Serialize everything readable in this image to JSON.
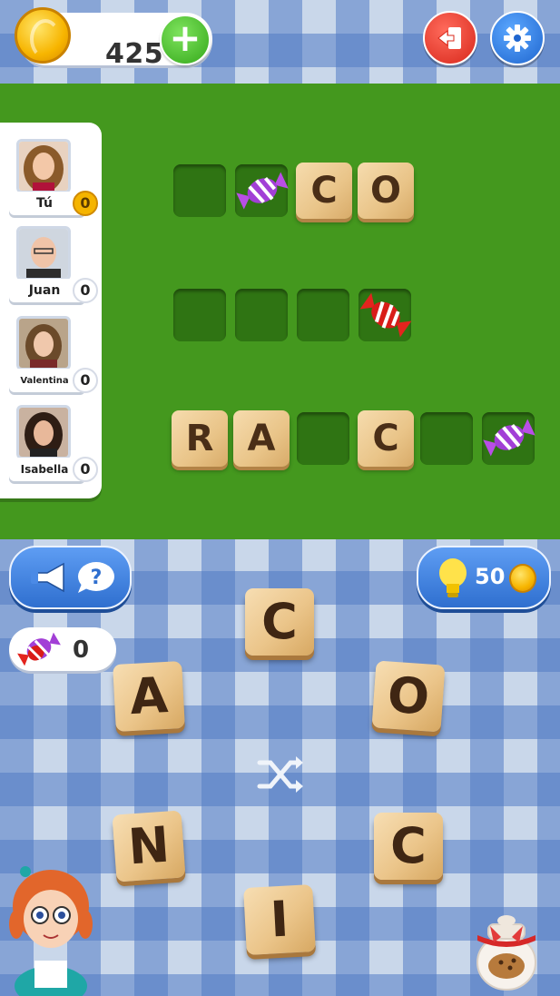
{
  "header": {
    "coins": "425",
    "icons": {
      "coin": "coin-icon",
      "add": "plus-icon",
      "exit": "exit-icon",
      "settings": "gear-icon"
    }
  },
  "players": [
    {
      "name": "Tú",
      "score": "0",
      "me": true
    },
    {
      "name": "Juan",
      "score": "0"
    },
    {
      "name": "Valentina",
      "score": "0"
    },
    {
      "name": "Isabella",
      "score": "0"
    }
  ],
  "board": {
    "rows": [
      [
        "",
        "candy-purple",
        "C",
        "O"
      ],
      [
        "",
        "",
        "",
        "candy-red"
      ],
      [
        "R",
        "A",
        "",
        "C",
        "",
        "candy-purple"
      ]
    ]
  },
  "actions": {
    "ask_icon": "megaphone-question-icon",
    "hint_price": "50",
    "candies": "0"
  },
  "letter_wheel": [
    "C",
    "O",
    "C",
    "I",
    "N",
    "A"
  ],
  "colors": {
    "board": "#44981e",
    "tile": "#e9c488",
    "letter": "#4a2e17",
    "cloth_blue": "#527cc4"
  }
}
